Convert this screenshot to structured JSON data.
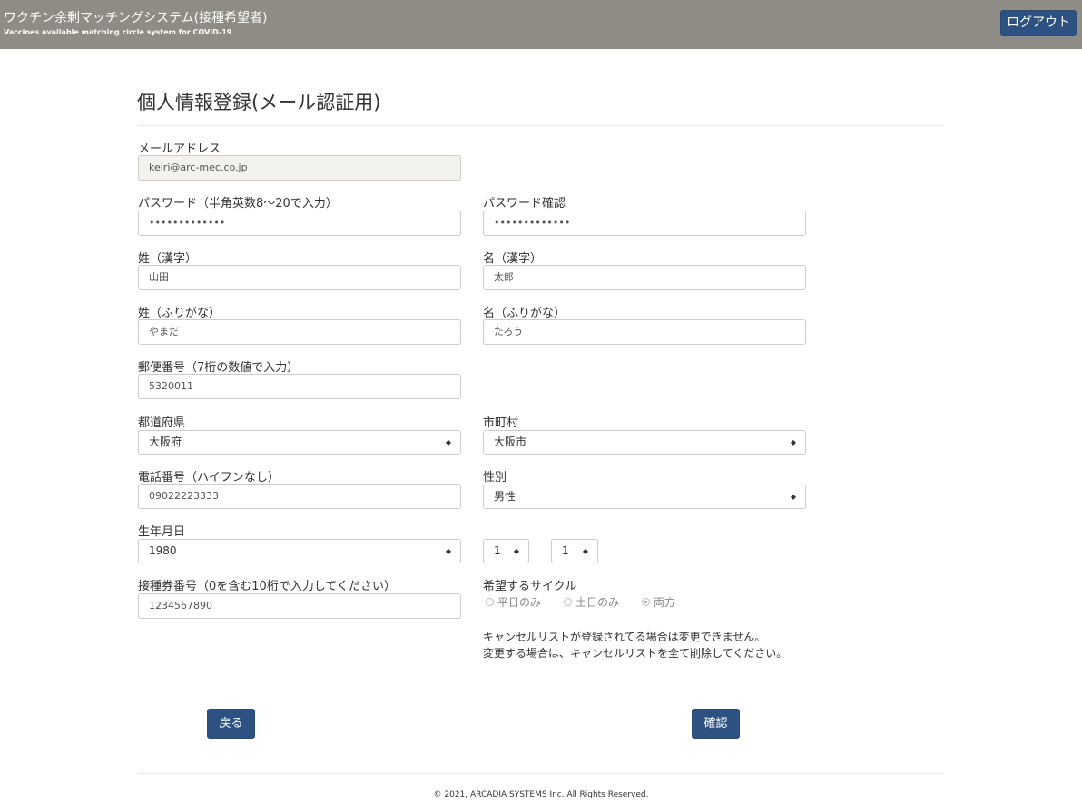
{
  "header": {
    "title": "ワクチン余剰マッチングシステム(接種希望者)",
    "subtitle": "Vaccines available matching circle system for COVID-19",
    "logout_label": "ログアウト"
  },
  "form": {
    "title": "個人情報登録(メール認証用)",
    "email": {
      "label": "メールアドレス",
      "value": "keiri@arc-mec.co.jp"
    },
    "password": {
      "label": "パスワード（半角英数8～20で入力）",
      "value": "•••••••••••••"
    },
    "password_confirm": {
      "label": "パスワード確認",
      "value": "•••••••••••••"
    },
    "last_name_kanji": {
      "label": "姓（漢字）",
      "value": "山田"
    },
    "first_name_kanji": {
      "label": "名（漢字）",
      "value": "太郎"
    },
    "last_name_kana": {
      "label": "姓（ふりがな）",
      "value": "やまだ"
    },
    "first_name_kana": {
      "label": "名（ふりがな）",
      "value": "たろう"
    },
    "postal_code": {
      "label": "郵便番号（7桁の数値で入力）",
      "value": "5320011"
    },
    "prefecture": {
      "label": "都道府県",
      "value": "大阪府"
    },
    "city": {
      "label": "市町村",
      "value": "大阪市"
    },
    "phone": {
      "label": "電話番号（ハイフンなし）",
      "value": "09022223333"
    },
    "gender": {
      "label": "性別",
      "value": "男性"
    },
    "birthdate": {
      "label": "生年月日",
      "year": "1980",
      "month": "1",
      "day": "1"
    },
    "voucher": {
      "label": "接種券番号（0を含む10桁で入力してください）",
      "value": "1234567890"
    },
    "cycle": {
      "label": "希望するサイクル",
      "options": [
        "平日のみ",
        "土日のみ",
        "両方"
      ],
      "selected": "両方"
    },
    "note_line1": "キャンセルリストが登録されてる場合は変更できません。",
    "note_line2": "変更する場合は、キャンセルリストを全て削除してください。",
    "back_label": "戻る",
    "confirm_label": "確認"
  },
  "footer": {
    "copyright": "© 2021, ARCADIA SYSTEMS Inc. All Rights Reserved."
  },
  "colors": {
    "header_bg": "#8f8b85",
    "button_bg": "#2d5281",
    "readonly_bg": "#f4f2ee"
  }
}
